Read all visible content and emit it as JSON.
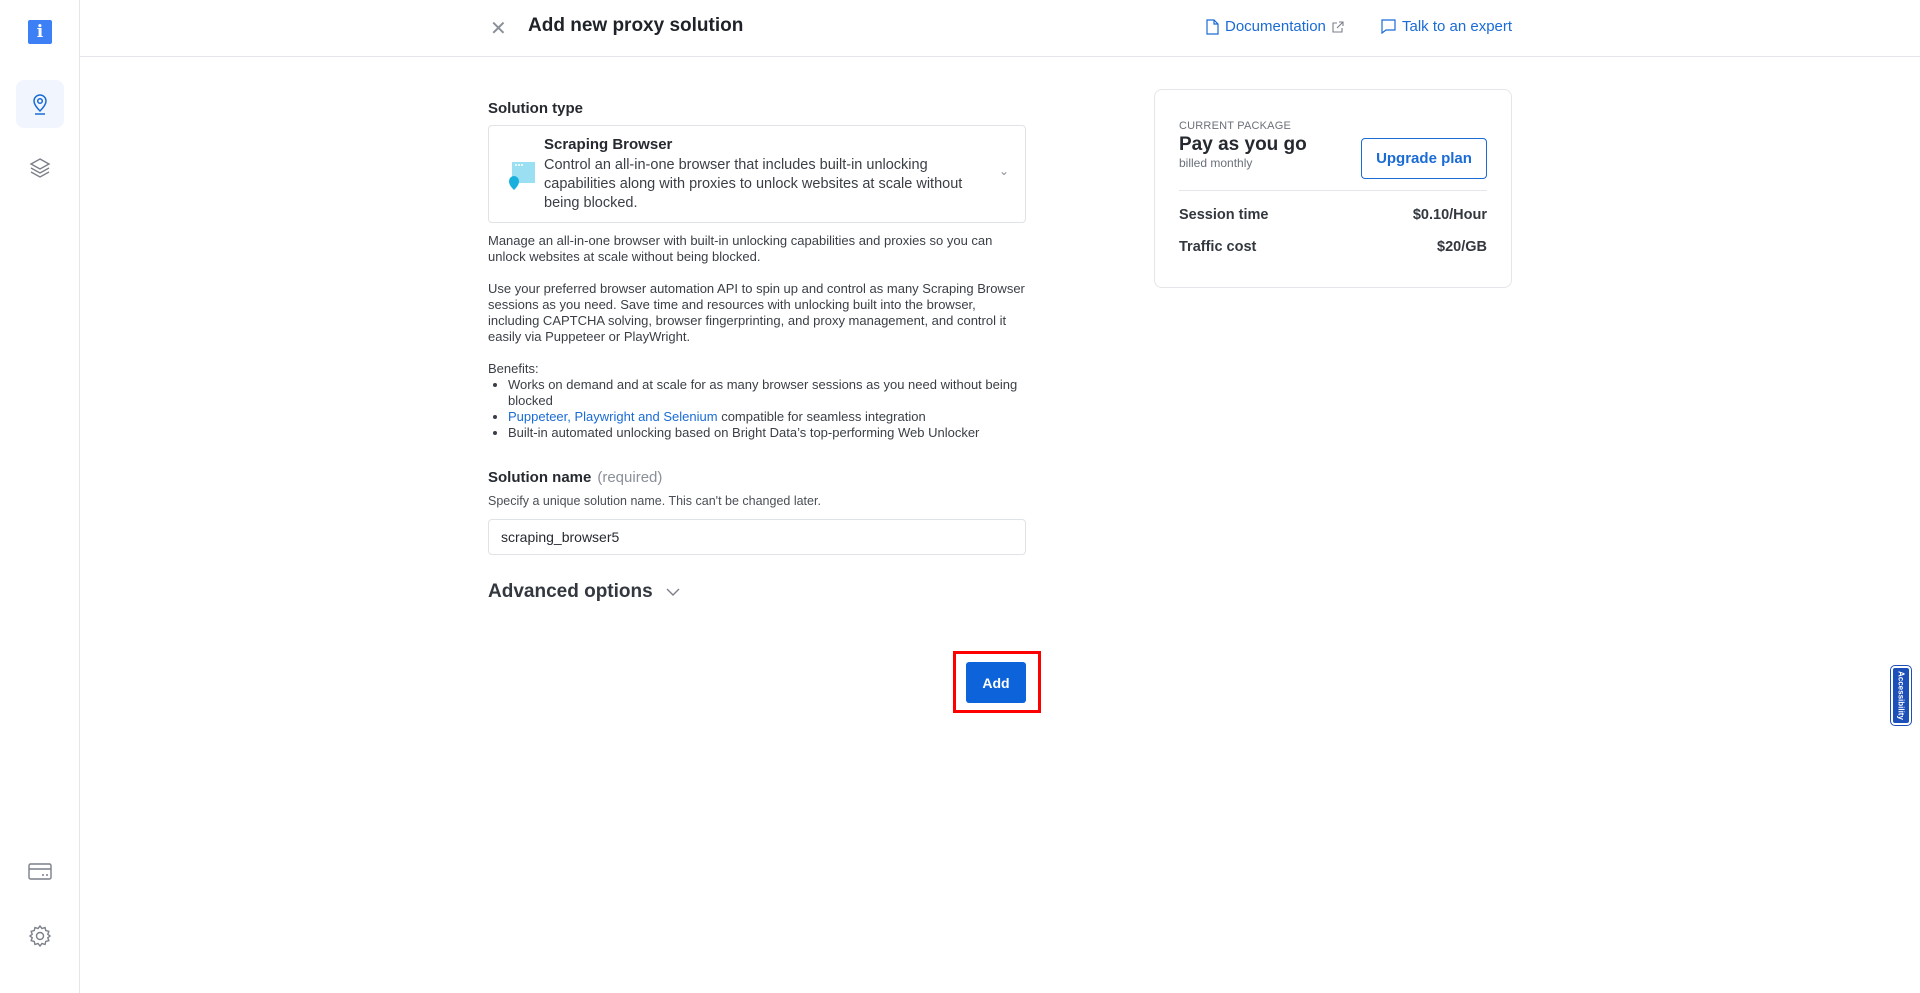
{
  "sidebar": {
    "logo": "i",
    "items": [
      {
        "icon": "location-pin-icon"
      },
      {
        "icon": "layers-icon"
      },
      {
        "icon": "billing-card-icon"
      },
      {
        "icon": "gear-icon"
      }
    ]
  },
  "header": {
    "title": "Add new proxy solution",
    "documentation": "Documentation",
    "talk": "Talk to an expert"
  },
  "form": {
    "solution_type_label": "Solution type",
    "selected": {
      "title": "Scraping Browser",
      "description": "Control an all-in-one browser that includes built-in unlocking capabilities along with proxies to unlock websites at scale without being blocked."
    },
    "para1": "Manage an all-in-one browser with built-in unlocking capabilities and proxies so you can unlock websites at scale without being blocked.",
    "para2": "Use your preferred browser automation API to spin up and control as many Scraping Browser sessions as you need. Save time and resources with unlocking built into the browser, including CAPTCHA solving, browser fingerprinting, and proxy management, and control it easily via Puppeteer or PlayWright.",
    "benefits_label": "Benefits:",
    "benefit1": "Works on demand and at scale for as many browser sessions as you need without being blocked",
    "benefit2_link": "Puppeteer, Playwright and Selenium",
    "benefit2_rest": " compatible for seamless integration",
    "benefit3": "Built-in automated unlocking based on Bright Data’s top-performing Web Unlocker",
    "name_label": "Solution name",
    "name_required": "(required)",
    "name_hint": "Specify a unique solution name. This can't be changed later.",
    "name_value": "scraping_browser5",
    "advanced": "Advanced options",
    "add": "Add"
  },
  "package": {
    "label": "CURRENT PACKAGE",
    "name": "Pay as you go",
    "billing": "billed monthly",
    "upgrade": "Upgrade plan",
    "rows": [
      {
        "k": "Session time",
        "v": "$0.10/Hour"
      },
      {
        "k": "Traffic cost",
        "v": "$20/GB"
      }
    ]
  },
  "accessibility": "Accessibility",
  "colors": {
    "accent": "#0d63d9",
    "link": "#1a6bd6",
    "highlight": "#ff0000"
  }
}
